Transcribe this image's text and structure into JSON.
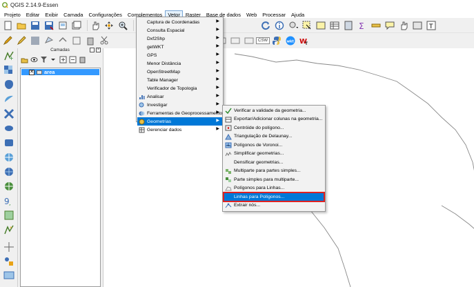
{
  "window": {
    "title": "QGIS 2.14.9-Essen"
  },
  "menubar": {
    "items": [
      {
        "label": "Projeto"
      },
      {
        "label": "Editar"
      },
      {
        "label": "Exibir"
      },
      {
        "label": "Camada"
      },
      {
        "label": "Configurações"
      },
      {
        "label": "Complementos"
      },
      {
        "label": "Vetor"
      },
      {
        "label": "Raster"
      },
      {
        "label": "Base de dados"
      },
      {
        "label": "Web"
      },
      {
        "label": "Processar"
      },
      {
        "label": "Ajuda"
      }
    ]
  },
  "toolbar2": {
    "csw_label": "CSW"
  },
  "layers_panel": {
    "title": "Camadas",
    "layer": {
      "name": "area",
      "checked": "✕"
    }
  },
  "vetor_menu": {
    "items": [
      {
        "label": "Captura de Coordenadas",
        "arrow": "▶"
      },
      {
        "label": "Consulta Espacial",
        "arrow": "▶"
      },
      {
        "label": "Dxf2Shp",
        "arrow": "▶"
      },
      {
        "label": "getWKT",
        "arrow": "▶"
      },
      {
        "label": "GPS",
        "arrow": "▶"
      },
      {
        "label": "Menor Distância",
        "arrow": "▶"
      },
      {
        "label": "OpenStreetMap",
        "arrow": "▶"
      },
      {
        "label": "Table Manager",
        "arrow": "▶"
      },
      {
        "label": "Verificador de Topologia",
        "arrow": "▶"
      },
      {
        "label": "Analisar",
        "arrow": "▶"
      },
      {
        "label": "Investigar",
        "arrow": "▶"
      },
      {
        "label": "Ferramentas de Geoprocessamento",
        "arrow": "▶"
      },
      {
        "label": "Geometrias",
        "arrow": "▶"
      },
      {
        "label": "Gerenciar dados",
        "arrow": "▶"
      }
    ]
  },
  "geometrias_menu": {
    "items": [
      {
        "label": "Verificar a validade da geometria..."
      },
      {
        "label": "Exportar/Adicionar colunas na geometria..."
      },
      {
        "label": "Centróide do polígono..."
      },
      {
        "label": "Triangulação de Delaunay..."
      },
      {
        "label": "Polígonos de Voronoi..."
      },
      {
        "label": "Simplificar geometrias..."
      },
      {
        "label": "Densificar geometrias..."
      },
      {
        "label": "Multiparte para partes simples..."
      },
      {
        "label": "Parte simples para multiparte..."
      },
      {
        "label": "Polígonos para Linhas..."
      },
      {
        "label": "Linhas para Polígonos..."
      },
      {
        "label": "Extrair nós..."
      }
    ]
  },
  "colors": {
    "selection": "#0078d7",
    "highlight_box": "#e02020",
    "layer_selected": "#3399ff"
  }
}
